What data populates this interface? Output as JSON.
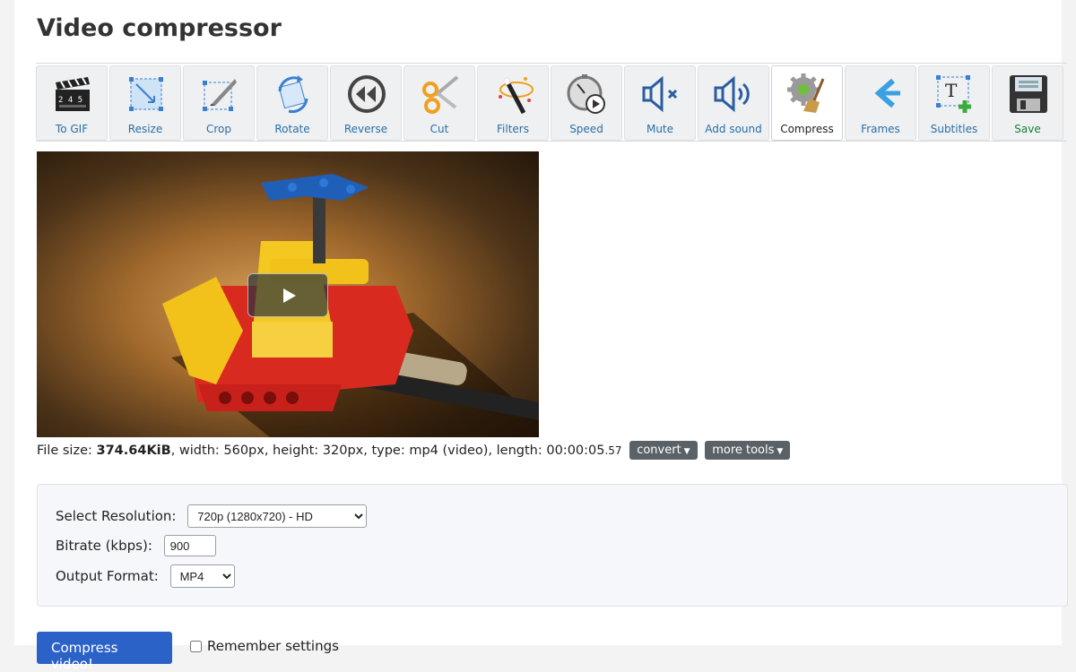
{
  "page": {
    "title": "Video compressor"
  },
  "tools": [
    {
      "label": "To GIF",
      "icon": "clapperboard-icon"
    },
    {
      "label": "Resize",
      "icon": "resize-icon"
    },
    {
      "label": "Crop",
      "icon": "crop-icon"
    },
    {
      "label": "Rotate",
      "icon": "rotate-icon"
    },
    {
      "label": "Reverse",
      "icon": "reverse-icon"
    },
    {
      "label": "Cut",
      "icon": "scissors-icon"
    },
    {
      "label": "Filters",
      "icon": "magic-wand-icon"
    },
    {
      "label": "Speed",
      "icon": "stopwatch-icon"
    },
    {
      "label": "Mute",
      "icon": "speaker-mute-icon"
    },
    {
      "label": "Add sound",
      "icon": "speaker-sound-icon"
    },
    {
      "label": "Compress",
      "icon": "gear-broom-icon"
    },
    {
      "label": "Frames",
      "icon": "frames-icon"
    },
    {
      "label": "Subtitles",
      "icon": "text-add-icon"
    },
    {
      "label": "Save",
      "icon": "floppy-disk-icon"
    }
  ],
  "video": {
    "play_icon": "play-icon"
  },
  "fileinfo": {
    "prefix": "File size: ",
    "size": "374.64KiB",
    "rest": ", width: 560px, height: 320px, type: mp4 (video), length: 00:00:05",
    "fraction": ".57",
    "convert_label": "convert",
    "more_tools_label": "more tools"
  },
  "options": {
    "resolution_label": "Select Resolution:",
    "resolution_value": "720p (1280x720) - HD",
    "bitrate_label": "Bitrate (kbps):",
    "bitrate_value": "900",
    "format_label": "Output Format:",
    "format_value": "MP4"
  },
  "actions": {
    "submit_label": "Compress video!",
    "remember_label": "Remember settings"
  },
  "colors": {
    "accent": "#2a62c8",
    "tool_label": "#2a6fa5",
    "save_label": "#188038"
  }
}
